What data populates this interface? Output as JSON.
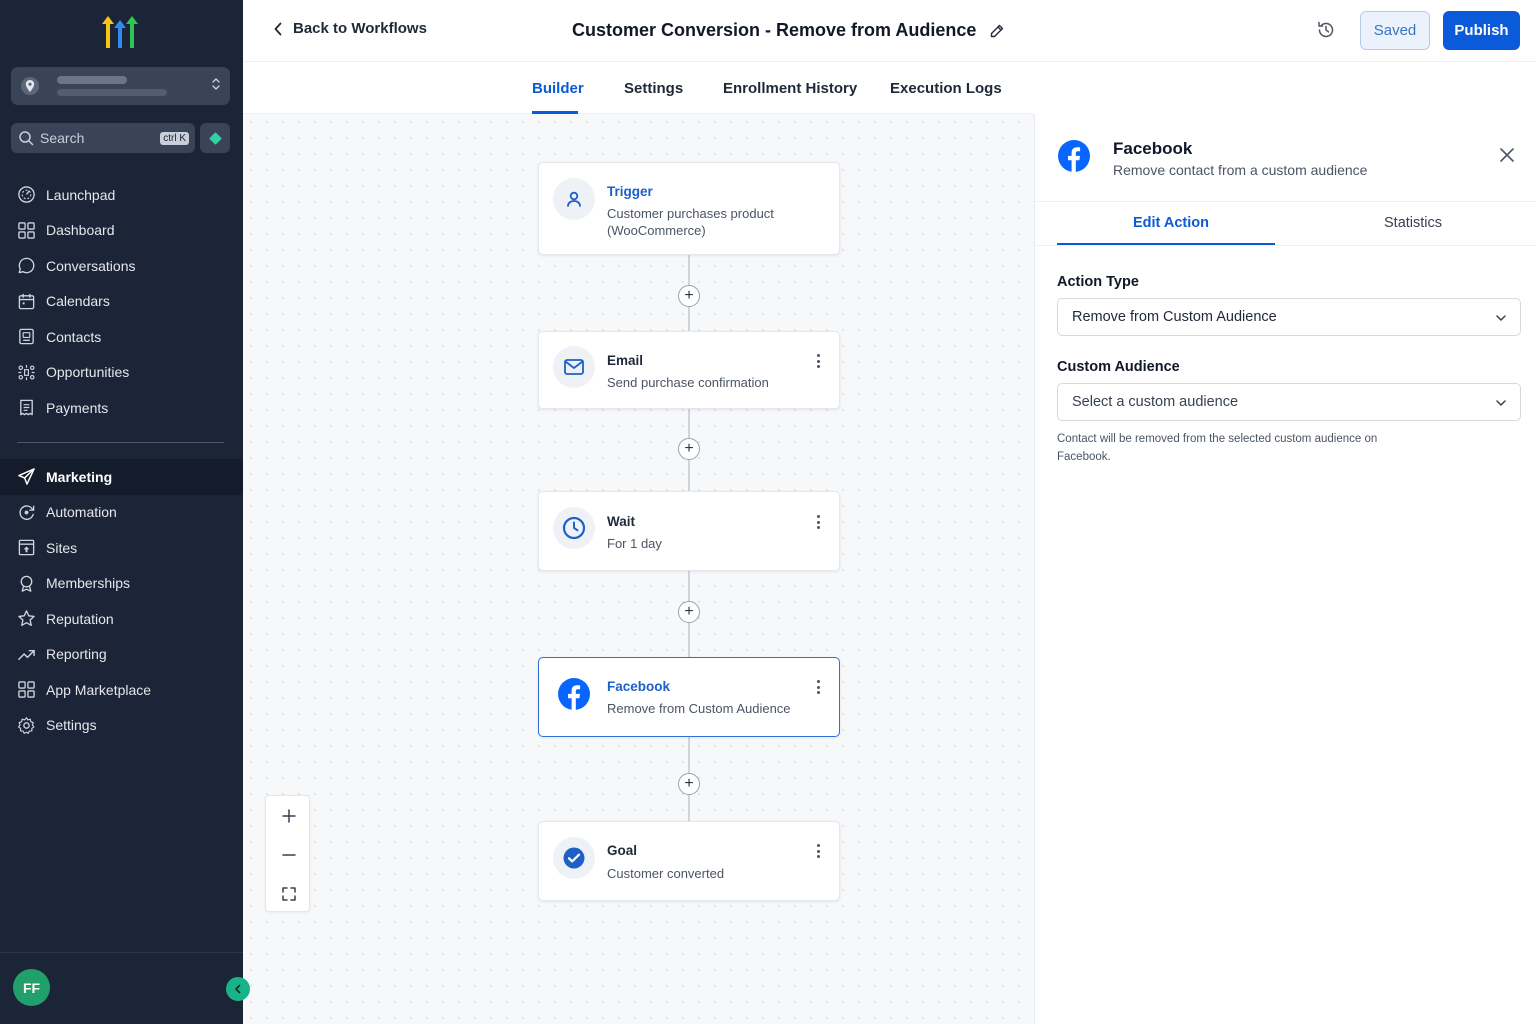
{
  "sidebar": {
    "search_placeholder": "Search",
    "search_shortcut": "ctrl K",
    "avatar_initials": "FF",
    "items": [
      {
        "label": "Launchpad"
      },
      {
        "label": "Dashboard"
      },
      {
        "label": "Conversations"
      },
      {
        "label": "Calendars"
      },
      {
        "label": "Contacts"
      },
      {
        "label": "Opportunities"
      },
      {
        "label": "Payments"
      }
    ],
    "items2": [
      {
        "label": "Marketing",
        "active": true
      },
      {
        "label": "Automation"
      },
      {
        "label": "Sites"
      },
      {
        "label": "Memberships"
      },
      {
        "label": "Reputation"
      },
      {
        "label": "Reporting"
      },
      {
        "label": "App Marketplace"
      },
      {
        "label": "Settings"
      }
    ]
  },
  "header": {
    "back_label": "Back to Workflows",
    "title": "Customer Conversion - Remove from Audience",
    "saved_label": "Saved",
    "publish_label": "Publish"
  },
  "tabs": [
    {
      "label": "Builder",
      "active": true
    },
    {
      "label": "Settings"
    },
    {
      "label": "Enrollment History"
    },
    {
      "label": "Execution Logs"
    }
  ],
  "workflow": {
    "nodes": [
      {
        "title": "Trigger",
        "subtitle": "Customer purchases product (WooCommerce)",
        "icon": "user-icon"
      },
      {
        "title": "Email",
        "subtitle": "Send purchase confirmation",
        "icon": "mail-icon"
      },
      {
        "title": "Wait",
        "subtitle": "For 1 day",
        "icon": "clock-icon"
      },
      {
        "title": "Facebook",
        "subtitle": "Remove from Custom Audience",
        "icon": "facebook-icon",
        "selected": true
      },
      {
        "title": "Goal",
        "subtitle": "Customer converted",
        "icon": "check-circle-icon"
      }
    ]
  },
  "panel": {
    "title": "Facebook",
    "subtitle": "Remove contact from a custom audience",
    "tabs": [
      {
        "label": "Edit Action",
        "active": true
      },
      {
        "label": "Statistics"
      }
    ],
    "action_type_label": "Action Type",
    "action_type_value": "Remove from Custom Audience",
    "custom_audience_label": "Custom Audience",
    "custom_audience_placeholder": "Select a custom audience",
    "help_text": "Contact will be removed from the selected custom audience on Facebook."
  },
  "colors": {
    "sidebar_bg": "#1b2537",
    "accent": "#0b5ad9",
    "facebook": "#0866ff",
    "avatar": "#22a06b"
  }
}
